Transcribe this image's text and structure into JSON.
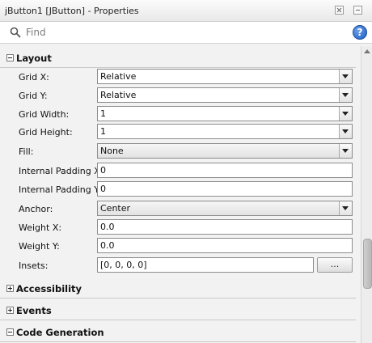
{
  "window": {
    "title": "jButton1 [JButton] - Properties"
  },
  "find": {
    "placeholder": "Find",
    "value": ""
  },
  "sections": {
    "layout": "Layout",
    "accessibility": "Accessibility",
    "events": "Events",
    "code_generation": "Code Generation"
  },
  "layout_props": {
    "grid_x": {
      "label": "Grid X:",
      "value": "Relative"
    },
    "grid_y": {
      "label": "Grid Y:",
      "value": "Relative"
    },
    "grid_width": {
      "label": "Grid Width:",
      "value": "1"
    },
    "grid_height": {
      "label": "Grid Height:",
      "value": "1"
    },
    "fill": {
      "label": "Fill:",
      "value": "None"
    },
    "internal_padding_x": {
      "label": "Internal Padding X:",
      "value": "0"
    },
    "internal_padding_y": {
      "label": "Internal Padding Y:",
      "value": "0"
    },
    "anchor": {
      "label": "Anchor:",
      "value": "Center"
    },
    "weight_x": {
      "label": "Weight X:",
      "value": "0.0"
    },
    "weight_y": {
      "label": "Weight Y:",
      "value": "0.0"
    },
    "insets": {
      "label": "Insets:",
      "value": "[0, 0, 0, 0]",
      "button": "..."
    }
  },
  "icons": {
    "search": "search-icon",
    "help": "help-icon",
    "close": "close-icon",
    "minimize": "minimize-icon",
    "expanded": "collapse-icon",
    "collapsed": "expand-icon"
  }
}
